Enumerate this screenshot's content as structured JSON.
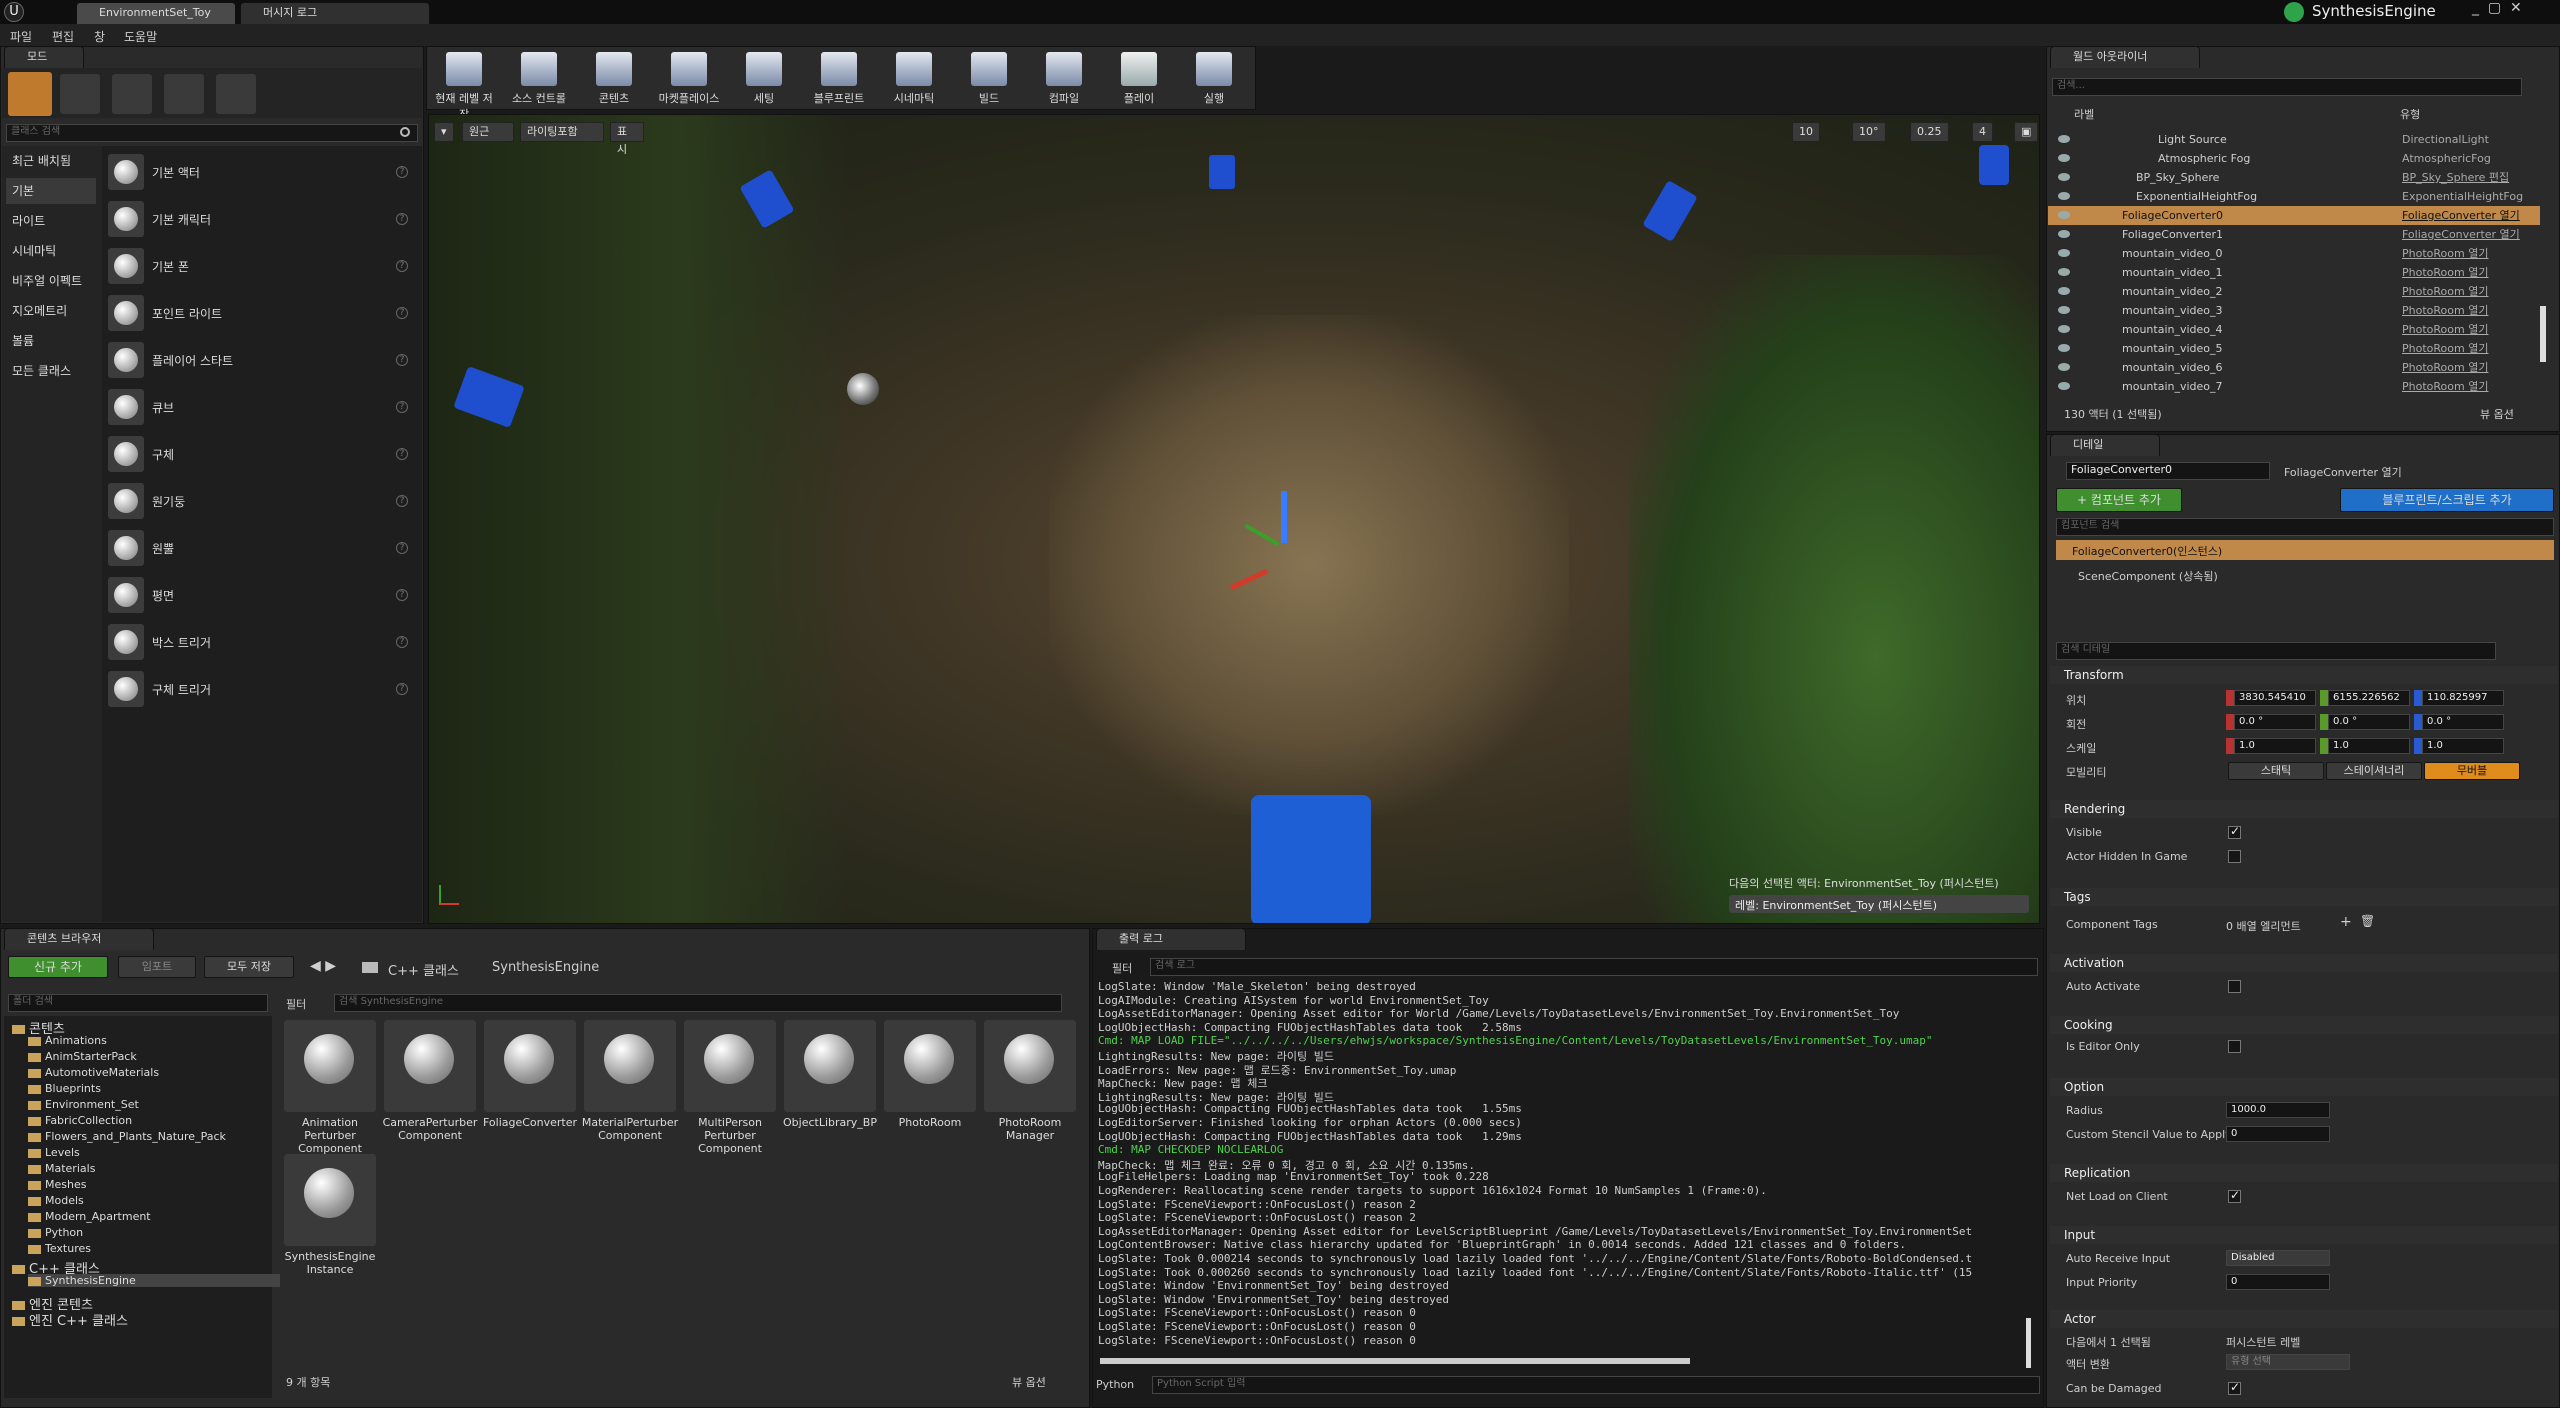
{
  "tabs": [
    {
      "label": "EnvironmentSet_Toy"
    },
    {
      "label": "머시지 로그"
    }
  ],
  "app_name": "SynthesisEngine",
  "menu": [
    "파일",
    "편집",
    "창",
    "도움말"
  ],
  "modes": {
    "tab": "모드",
    "search_placeholder": "클래스 검색",
    "categories": [
      "최근 배치됨",
      "기본",
      "라이트",
      "시네마틱",
      "비주얼 이펙트",
      "지오메트리",
      "볼륨",
      "모든 클래스"
    ],
    "items": [
      "기본 액터",
      "기본 캐릭터",
      "기본 폰",
      "포인트 라이트",
      "플레이어 스타트",
      "큐브",
      "구체",
      "원기둥",
      "원뿔",
      "평면",
      "박스 트리거",
      "구체 트리거"
    ]
  },
  "toolbar": [
    "현재 레벨 저장",
    "소스 컨트롤",
    "콘텐츠",
    "마켓플레이스",
    "세팅",
    "블루프린트",
    "시네마틱",
    "빌드",
    "컴파일",
    "플레이",
    "실행"
  ],
  "viewport": {
    "buttons": [
      "원근",
      "라이팅포함",
      "표시"
    ],
    "grid": "10",
    "rot": "10°",
    "scale": "0.25",
    "cam": "4",
    "info": "다음의 선택된 액터: EnvironmentSet_Toy (퍼시스턴트)",
    "level": "레벨: EnvironmentSet_Toy (퍼시스턴트)"
  },
  "outliner": {
    "tab": "월드 아웃라이너",
    "search_placeholder": "검색...",
    "col_label": "라벨",
    "col_type": "유형",
    "rows": [
      {
        "name": "Light Source",
        "type": "DirectionalLight",
        "link": false
      },
      {
        "name": "Atmospheric Fog",
        "type": "AtmosphericFog",
        "link": false
      },
      {
        "name": "BP_Sky_Sphere",
        "type": "BP_Sky_Sphere 편집",
        "link": true
      },
      {
        "name": "ExponentialHeightFog",
        "type": "ExponentialHeightFog",
        "link": false
      },
      {
        "name": "FoliageConverter0",
        "type": "FoliageConverter 열기",
        "link": true
      },
      {
        "name": "FoliageConverter1",
        "type": "FoliageConverter 열기",
        "link": true
      },
      {
        "name": "mountain_video_0",
        "type": "PhotoRoom 열기",
        "link": true
      },
      {
        "name": "mountain_video_1",
        "type": "PhotoRoom 열기",
        "link": true
      },
      {
        "name": "mountain_video_2",
        "type": "PhotoRoom 열기",
        "link": true
      },
      {
        "name": "mountain_video_3",
        "type": "PhotoRoom 열기",
        "link": true
      },
      {
        "name": "mountain_video_4",
        "type": "PhotoRoom 열기",
        "link": true
      },
      {
        "name": "mountain_video_5",
        "type": "PhotoRoom 열기",
        "link": true
      },
      {
        "name": "mountain_video_6",
        "type": "PhotoRoom 열기",
        "link": true
      },
      {
        "name": "mountain_video_7",
        "type": "PhotoRoom 열기",
        "link": true
      }
    ],
    "count": "130 액터 (1 선택됨)",
    "view_options": "뷰 옵션"
  },
  "details": {
    "tab": "디테일",
    "name": "FoliageConverter0",
    "open_link": "FoliageConverter 열기",
    "add_component": "+ 컴포넌트 추가",
    "add_blueprint": "블루프린트/스크립트 추가",
    "comp_search": "컴포넌트 검색",
    "instance": "FoliageConverter0(인스턴스)",
    "scene": "SceneComponent (상속됨)",
    "detail_search": "검색 디테일",
    "transform": {
      "head": "Transform",
      "loc_label": "위치",
      "rot_label": "회전",
      "scale_label": "스케일",
      "mob_label": "모빌리티",
      "loc": [
        "3830.545410",
        "6155.226562",
        "110.825997"
      ],
      "rot": [
        "0.0 °",
        "0.0 °",
        "0.0 °"
      ],
      "scale": [
        "1.0",
        "1.0",
        "1.0"
      ],
      "mobility": [
        "스태틱",
        "스테이셔너리",
        "무버블"
      ]
    },
    "rendering": {
      "head": "Rendering",
      "visible": "Visible",
      "hidden": "Actor Hidden In Game"
    },
    "tags": {
      "head": "Tags",
      "comp_tags": "Component Tags",
      "value": "0 배열 엘리먼트"
    },
    "activation": {
      "head": "Activation",
      "auto": "Auto Activate"
    },
    "cooking": {
      "head": "Cooking",
      "editor_only": "Is Editor Only"
    },
    "option": {
      "head": "Option",
      "radius": "Radius",
      "radius_val": "1000.0",
      "stencil": "Custom Stencil Value to Apply",
      "stencil_val": "0"
    },
    "replication": {
      "head": "Replication",
      "net": "Net Load on Client"
    },
    "input": {
      "head": "Input",
      "auto_recv": "Auto Receive Input",
      "auto_recv_val": "Disabled",
      "priority": "Input Priority",
      "priority_val": "0"
    },
    "actor": {
      "head": "Actor",
      "selected": "다음에서 1 선택됨",
      "level": "퍼시스턴트 레벨",
      "convert": "액터 변환",
      "convert_val": "유형 선택",
      "damaged": "Can be Damaged"
    }
  },
  "content": {
    "tab": "콘텐츠 브라우저",
    "new": "신규 추가",
    "import": "임포트",
    "save_all": "모두 저장",
    "crumbs": [
      "C++ 클래스",
      "SynthesisEngine"
    ],
    "folder_search": "폴더 검색",
    "filter": "필터",
    "search_placeholder": "검색 SynthesisEngine",
    "tree": [
      "콘텐츠",
      "Animations",
      "AnimStarterPack",
      "AutomotiveMaterials",
      "Blueprints",
      "Environment_Set",
      "FabricCollection",
      "Flowers_and_Plants_Nature_Pack",
      "Levels",
      "Materials",
      "Meshes",
      "Models",
      "Modern_Apartment",
      "Python",
      "Textures",
      "C++ 클래스",
      "SynthesisEngine",
      "엔진 콘텐츠",
      "엔진 C++ 클래스"
    ],
    "assets": [
      "Animation Perturber Component",
      "CameraPerturber Component",
      "FoliageConverter",
      "MaterialPerturber Component",
      "MultiPerson Perturber Component",
      "ObjectLibrary_BP",
      "PhotoRoom",
      "PhotoRoom Manager",
      "SynthesisEngine Instance"
    ],
    "count": "9 개 항목",
    "view_options": "뷰 옵션"
  },
  "log": {
    "tab": "출력 로그",
    "filter": "필터",
    "search_placeholder": "검색 로그",
    "python": "Python",
    "python_placeholder": "Python Script 입력",
    "lines": [
      {
        "t": "LogSlate: Window 'Male_Skeleton' being destroyed",
        "c": "n"
      },
      {
        "t": "LogAIModule: Creating AISystem for world EnvironmentSet_Toy",
        "c": "n"
      },
      {
        "t": "LogAssetEditorManager: Opening Asset editor for World /Game/Levels/ToyDatasetLevels/EnvironmentSet_Toy.EnvironmentSet_Toy",
        "c": "n"
      },
      {
        "t": "LogUObjectHash: Compacting FUObjectHashTables data took   2.58ms",
        "c": "n"
      },
      {
        "t": "Cmd: MAP LOAD FILE=\"../../../../Users/ehwjs/workspace/SynthesisEngine/Content/Levels/ToyDatasetLevels/EnvironmentSet_Toy.umap\"",
        "c": "g"
      },
      {
        "t": "LightingResults: New page: 라이팅 빌드",
        "c": "n"
      },
      {
        "t": "LoadErrors: New page: 맵 로드중: EnvironmentSet_Toy.umap",
        "c": "n"
      },
      {
        "t": "MapCheck: New page: 맵 체크",
        "c": "n"
      },
      {
        "t": "LightingResults: New page: 라이팅 빌드",
        "c": "n"
      },
      {
        "t": "LogUObjectHash: Compacting FUObjectHashTables data took   1.55ms",
        "c": "n"
      },
      {
        "t": "LogEditorServer: Finished looking for orphan Actors (0.000 secs)",
        "c": "n"
      },
      {
        "t": "LogUObjectHash: Compacting FUObjectHashTables data took   1.29ms",
        "c": "n"
      },
      {
        "t": "Cmd: MAP CHECKDEP NOCLEARLOG",
        "c": "g"
      },
      {
        "t": "MapCheck: 맵 체크 완료: 오류 0 회, 경고 0 회, 소요 시간 0.135ms.",
        "c": "n"
      },
      {
        "t": "LogFileHelpers: Loading map 'EnvironmentSet_Toy' took 0.228",
        "c": "n"
      },
      {
        "t": "LogRenderer: Reallocating scene render targets to support 1616x1024 Format 10 NumSamples 1 (Frame:0).",
        "c": "n"
      },
      {
        "t": "LogSlate: FSceneViewport::OnFocusLost() reason 2",
        "c": "n"
      },
      {
        "t": "LogSlate: FSceneViewport::OnFocusLost() reason 2",
        "c": "n"
      },
      {
        "t": "LogAssetEditorManager: Opening Asset editor for LevelScriptBlueprint /Game/Levels/ToyDatasetLevels/EnvironmentSet_Toy.EnvironmentSet",
        "c": "n"
      },
      {
        "t": "LogContentBrowser: Native class hierarchy updated for 'BlueprintGraph' in 0.0014 seconds. Added 121 classes and 0 folders.",
        "c": "n"
      },
      {
        "t": "LogSlate: Took 0.000214 seconds to synchronously load lazily loaded font '../../../Engine/Content/Slate/Fonts/Roboto-BoldCondensed.t",
        "c": "n"
      },
      {
        "t": "LogSlate: Took 0.000260 seconds to synchronously load lazily loaded font '../../../Engine/Content/Slate/Fonts/Roboto-Italic.ttf' (15",
        "c": "n"
      },
      {
        "t": "LogSlate: Window 'EnvironmentSet_Toy' being destroyed",
        "c": "n"
      },
      {
        "t": "LogSlate: Window 'EnvironmentSet_Toy' being destroyed",
        "c": "n"
      },
      {
        "t": "LogSlate: FSceneViewport::OnFocusLost() reason 0",
        "c": "n"
      },
      {
        "t": "LogSlate: FSceneViewport::OnFocusLost() reason 0",
        "c": "n"
      },
      {
        "t": "LogSlate: FSceneViewport::OnFocusLost() reason 0",
        "c": "n"
      }
    ]
  },
  "colors": {
    "accent_green": "#3f8f2f",
    "accent_blue": "#1f6fc9",
    "selected_row": "#c0894a",
    "log_green": "#4fd24f"
  }
}
